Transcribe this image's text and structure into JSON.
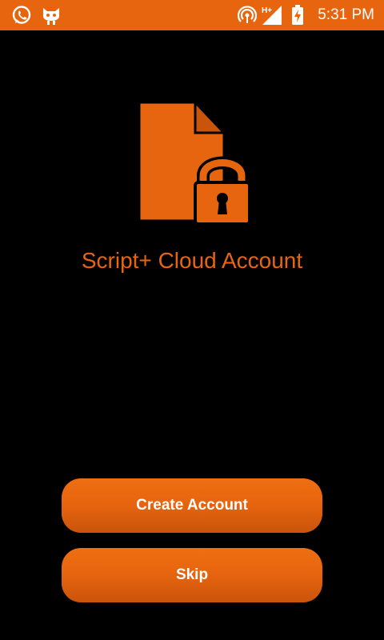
{
  "status_bar": {
    "time": "5:31 PM",
    "background": "#E8650F",
    "icons": [
      "whatsapp-icon",
      "cat-notification-icon",
      "hotspot-icon",
      "hplus-signal-icon",
      "battery-charging-icon"
    ],
    "network_label": "H+"
  },
  "hero": {
    "icon": "locked-document-icon",
    "title": "Script+ Cloud Account",
    "accent": "#E8650F"
  },
  "actions": {
    "create_account_label": "Create Account",
    "skip_label": "Skip"
  }
}
